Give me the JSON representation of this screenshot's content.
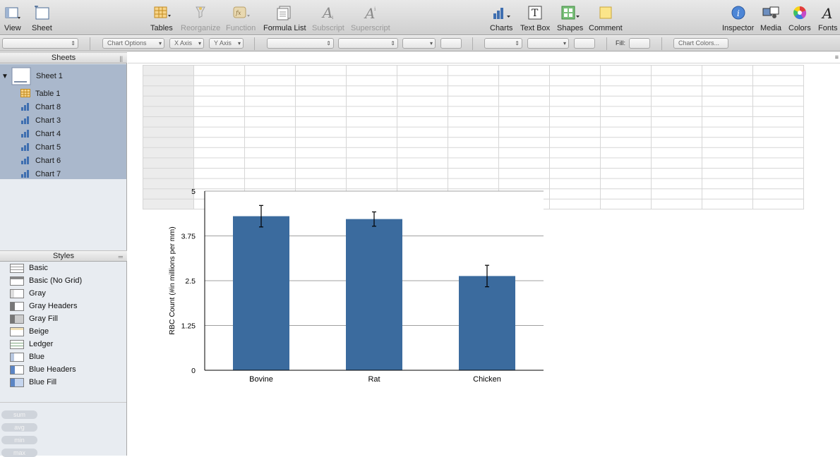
{
  "toolbar": {
    "left": [
      {
        "label": "View",
        "icon": "view-icon"
      },
      {
        "label": "Sheet",
        "icon": "sheet-icon"
      }
    ],
    "middle": [
      {
        "label": "Tables",
        "icon": "tables-icon",
        "enabled": true
      },
      {
        "label": "Reorganize",
        "icon": "reorganize-icon",
        "enabled": false
      },
      {
        "label": "Function",
        "icon": "function-icon",
        "enabled": false
      },
      {
        "label": "Formula List",
        "icon": "formula-list-icon",
        "enabled": true
      },
      {
        "label": "Subscript",
        "icon": "subscript-icon",
        "enabled": false
      },
      {
        "label": "Superscript",
        "icon": "superscript-icon",
        "enabled": false
      }
    ],
    "insert": [
      {
        "label": "Charts",
        "icon": "charts-icon"
      },
      {
        "label": "Text Box",
        "icon": "text-box-icon"
      },
      {
        "label": "Shapes",
        "icon": "shapes-icon"
      },
      {
        "label": "Comment",
        "icon": "comment-icon"
      }
    ],
    "right": [
      {
        "label": "Inspector",
        "icon": "inspector-icon"
      },
      {
        "label": "Media",
        "icon": "media-icon"
      },
      {
        "label": "Colors",
        "icon": "colors-icon"
      },
      {
        "label": "Fonts",
        "icon": "fonts-icon"
      }
    ]
  },
  "formatbar": {
    "chart_options": "Chart Options",
    "x_axis": "X Axis",
    "y_axis": "Y Axis",
    "fill_label": "Fill:",
    "chart_colors": "Chart Colors..."
  },
  "sidebar": {
    "sheets_header": "Sheets",
    "sheet_name": "Sheet 1",
    "items": [
      {
        "label": "Table 1",
        "type": "table"
      },
      {
        "label": "Chart 8",
        "type": "chart"
      },
      {
        "label": "Chart 3",
        "type": "chart"
      },
      {
        "label": "Chart 4",
        "type": "chart"
      },
      {
        "label": "Chart 5",
        "type": "chart"
      },
      {
        "label": "Chart 6",
        "type": "chart"
      },
      {
        "label": "Chart 7",
        "type": "chart"
      }
    ],
    "styles_header": "Styles",
    "styles": [
      {
        "label": "Basic"
      },
      {
        "label": "Basic (No Grid)"
      },
      {
        "label": "Gray"
      },
      {
        "label": "Gray Headers"
      },
      {
        "label": "Gray Fill"
      },
      {
        "label": "Beige"
      },
      {
        "label": "Ledger"
      },
      {
        "label": "Blue"
      },
      {
        "label": "Blue Headers"
      },
      {
        "label": "Blue Fill"
      }
    ],
    "functions": [
      "sum",
      "avg",
      "min",
      "max"
    ]
  },
  "colors": {
    "bar": "#3b6b9e",
    "sidebar_selected": "#aab8cc",
    "toolbar_icon_blue": "#3f6fb0"
  },
  "chart_data": {
    "type": "bar",
    "categories": [
      "Bovine",
      "Rat",
      "Chicken"
    ],
    "values": [
      4.3,
      4.22,
      2.63
    ],
    "error_bars": [
      0.3,
      0.2,
      0.3
    ],
    "ylabel": "RBC Count (#in millions per mm)",
    "ylim": [
      0,
      5
    ],
    "yticks": [
      "0",
      "1.25",
      "2.5",
      "3.75",
      "5"
    ],
    "grid": true
  }
}
